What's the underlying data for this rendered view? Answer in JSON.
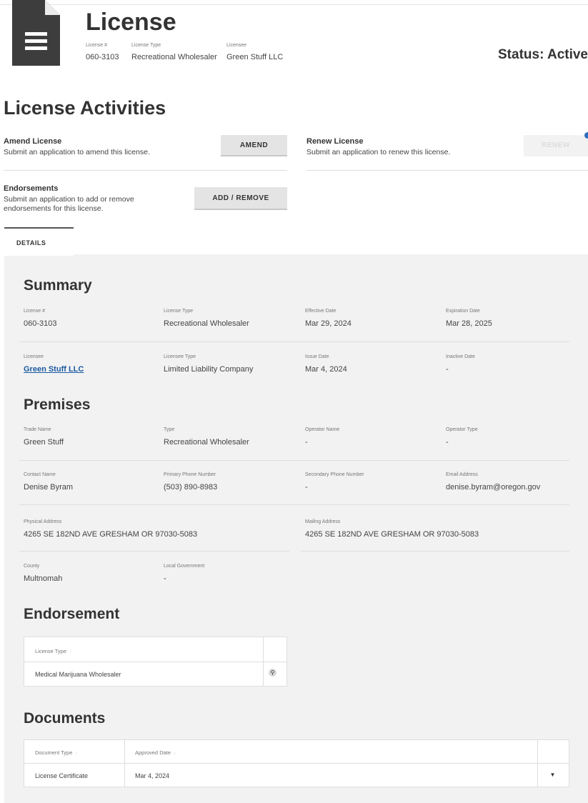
{
  "header": {
    "icon": "document-icon",
    "title": "License",
    "fields": [
      {
        "label": "License #",
        "value": "060-3103"
      },
      {
        "label": "License Type",
        "value": "Recreational Wholesaler"
      },
      {
        "label": "Licensee",
        "value": "Green Stuff LLC"
      }
    ],
    "status": "Status: Active"
  },
  "activities": {
    "heading": "License Activities",
    "amend": {
      "title": "Amend License",
      "desc": "Submit an application to amend this license.",
      "button": "AMEND"
    },
    "renew": {
      "title": "Renew License",
      "desc": "Submit an application to renew this license.",
      "button": "RENEW"
    },
    "endorsements": {
      "title": "Endorsements",
      "desc_line1": "Submit an application to add or remove",
      "desc_line2": "endorsements for this license.",
      "button": "ADD / REMOVE"
    }
  },
  "tabs": [
    {
      "label": "DETAILS"
    }
  ],
  "summary": {
    "heading": "Summary",
    "license_no": {
      "label": "License #",
      "value": "060-3103"
    },
    "license_type": {
      "label": "License Type",
      "value": "Recreational Wholesaler"
    },
    "effective_date": {
      "label": "Effective Date",
      "value": "Mar 29, 2024"
    },
    "expiration_date": {
      "label": "Expiration Date",
      "value": "Mar 28, 2025"
    },
    "licensee": {
      "label": "Licensee",
      "value": "Green Stuff LLC"
    },
    "licensee_type": {
      "label": "Licensee Type",
      "value": "Limited Liability Company"
    },
    "issue_date": {
      "label": "Issue Date",
      "value": "Mar 4, 2024"
    },
    "inactive_date": {
      "label": "Inactive Date",
      "value": "-"
    }
  },
  "premises": {
    "heading": "Premises",
    "trade_name": {
      "label": "Trade Name",
      "value": "Green Stuff"
    },
    "type": {
      "label": "Type",
      "value": "Recreational Wholesaler"
    },
    "operator_name": {
      "label": "Operator Name",
      "value": "-"
    },
    "operator_type": {
      "label": "Operator Type",
      "value": "-"
    },
    "contact_name": {
      "label": "Contact Name",
      "value": "Denise Byram"
    },
    "primary_phone": {
      "label": "Primary Phone Number",
      "value": "(503) 890-8983"
    },
    "secondary_phone": {
      "label": "Secondary Phone Number",
      "value": "-"
    },
    "email": {
      "label": "Email Address",
      "value": "denise.byram@oregon.gov"
    },
    "physical_address": {
      "label": "Physical Address",
      "value": "4265 SE 182ND AVE GRESHAM OR 97030-5083"
    },
    "mailing_address": {
      "label": "Mailing Address",
      "value": "4265 SE 182ND AVE GRESHAM OR 97030-5083"
    },
    "county": {
      "label": "County",
      "value": "Multnomah"
    },
    "local_government": {
      "label": "Local Government",
      "value": "-"
    }
  },
  "endorsement": {
    "heading": "Endorsement",
    "col_license_type": "License Type",
    "rows": [
      {
        "license_type": "Medical Marijuana Wholesaler",
        "icon": "magnify-icon"
      }
    ]
  },
  "documents": {
    "heading": "Documents",
    "col_document_type": "Document Type",
    "col_approved_date": "Approved Date",
    "rows": [
      {
        "document_type": "License Certificate",
        "approved_date": "Mar 4, 2024",
        "icon": "download-icon"
      }
    ]
  },
  "colors": {
    "link": "#1a5aa0",
    "panel": "#f2f2f2",
    "help": "#2a6ebb"
  }
}
